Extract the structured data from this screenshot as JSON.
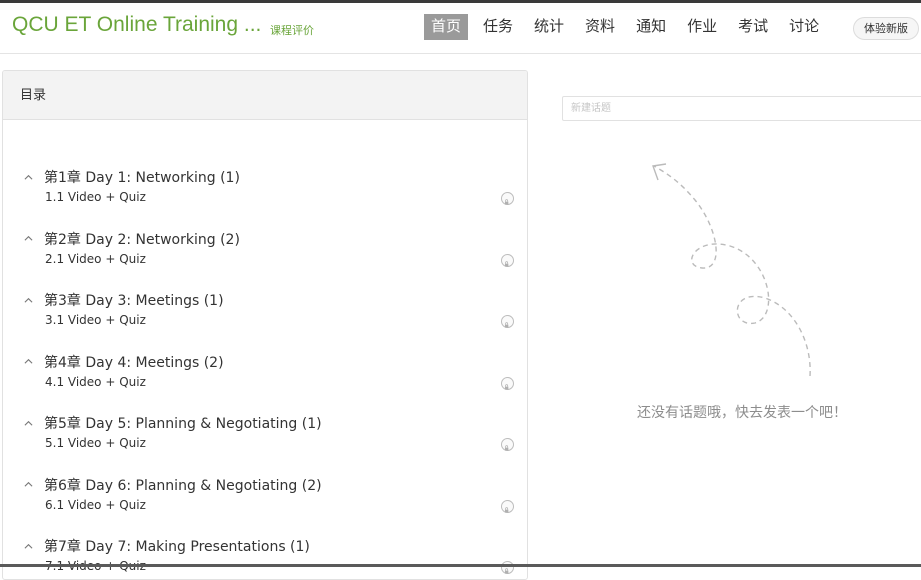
{
  "header": {
    "course_title": "QCU ET Online Training ...",
    "course_sub": "课程评价",
    "nav": [
      "首页",
      "任务",
      "统计",
      "资料",
      "通知",
      "作业",
      "考试",
      "讨论"
    ],
    "new_version": "体验新版"
  },
  "toc": {
    "title": "目录",
    "chapters": [
      {
        "title": "第1章 Day 1: Networking (1)",
        "lesson": "1.1  Video + Quiz"
      },
      {
        "title": "第2章 Day 2: Networking (2)",
        "lesson": "2.1  Video + Quiz"
      },
      {
        "title": "第3章 Day 3: Meetings (1)",
        "lesson": "3.1  Video + Quiz"
      },
      {
        "title": "第4章 Day 4: Meetings (2)",
        "lesson": "4.1  Video + Quiz"
      },
      {
        "title": "第5章 Day 5: Planning & Negotiating (1)",
        "lesson": "5.1  Video + Quiz"
      },
      {
        "title": "第6章 Day 6: Planning & Negotiating (2)",
        "lesson": "6.1  Video + Quiz"
      },
      {
        "title": "第7章 Day 7: Making Presentations (1)",
        "lesson": "7.1  Video + Quiz"
      }
    ]
  },
  "discussion": {
    "placeholder": "新建话题",
    "empty_text": "还没有话题哦，快去发表一个吧！"
  },
  "colors": {
    "brand_green": "#6aa53a",
    "nav_active": "#9a9a9a"
  }
}
